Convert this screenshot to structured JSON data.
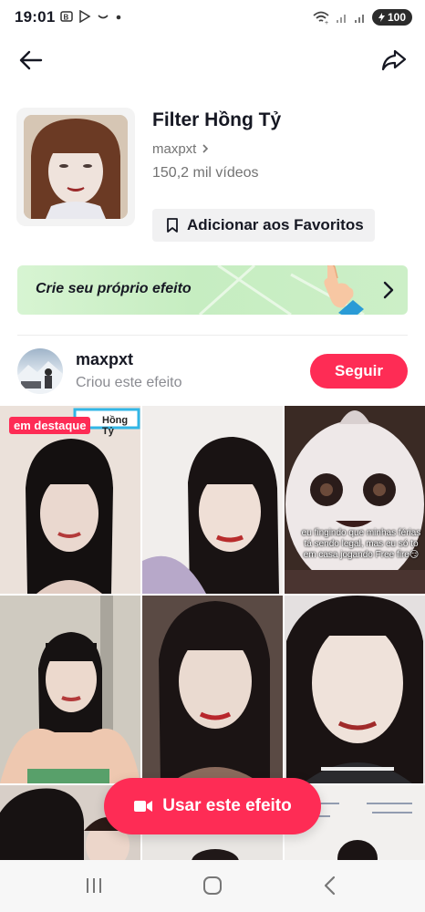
{
  "status_bar": {
    "time": "19:01",
    "battery": "100"
  },
  "effect": {
    "title": "Filter Hồng Tỷ",
    "creator_link": "maxpxt",
    "video_count": "150,2 mil vídeos",
    "favorite_label": "Adicionar aos Favoritos"
  },
  "banner": {
    "label": "Crie seu próprio efeito"
  },
  "creator": {
    "name": "maxpxt",
    "subtitle": "Criou este efeito",
    "follow_label": "Seguir"
  },
  "grid": {
    "featured_badge": "em destaque",
    "preview_label": "Hồng Tỷ",
    "video_caption": "eu fingindo que minhas férias tá sendo legal, mas eu só to em casa jogando Free fire😏"
  },
  "cta": {
    "label": "Usar este efeito"
  },
  "colors": {
    "accent": "#fe2c55",
    "banner_bg": "#c6edc1"
  }
}
